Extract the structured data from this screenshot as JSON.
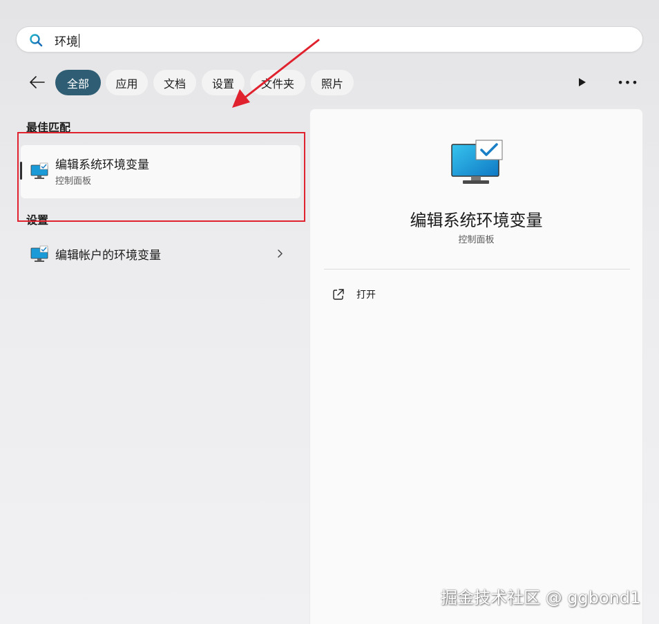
{
  "search": {
    "query": "环境"
  },
  "filters": [
    {
      "label": "全部",
      "active": true
    },
    {
      "label": "应用"
    },
    {
      "label": "文档"
    },
    {
      "label": "设置"
    },
    {
      "label": "文件夹"
    },
    {
      "label": "照片"
    }
  ],
  "results": {
    "best_match_heading": "最佳匹配",
    "best_match": {
      "title": "编辑系统环境变量",
      "subtitle": "控制面板",
      "icon": "monitor-check-icon"
    },
    "settings_heading": "设置",
    "settings_items": [
      {
        "title": "编辑帐户的环境变量",
        "icon": "monitor-check-icon"
      }
    ]
  },
  "preview": {
    "title": "编辑系统环境变量",
    "subtitle": "控制面板",
    "actions": [
      {
        "label": "打开",
        "icon": "open-external-icon"
      }
    ]
  },
  "watermark": "掘金技术社区 @ ggbond1",
  "colors": {
    "accent": "#2f5d73",
    "annotation_red": "#e0212e",
    "icon_blue": "#1a9ad6"
  }
}
